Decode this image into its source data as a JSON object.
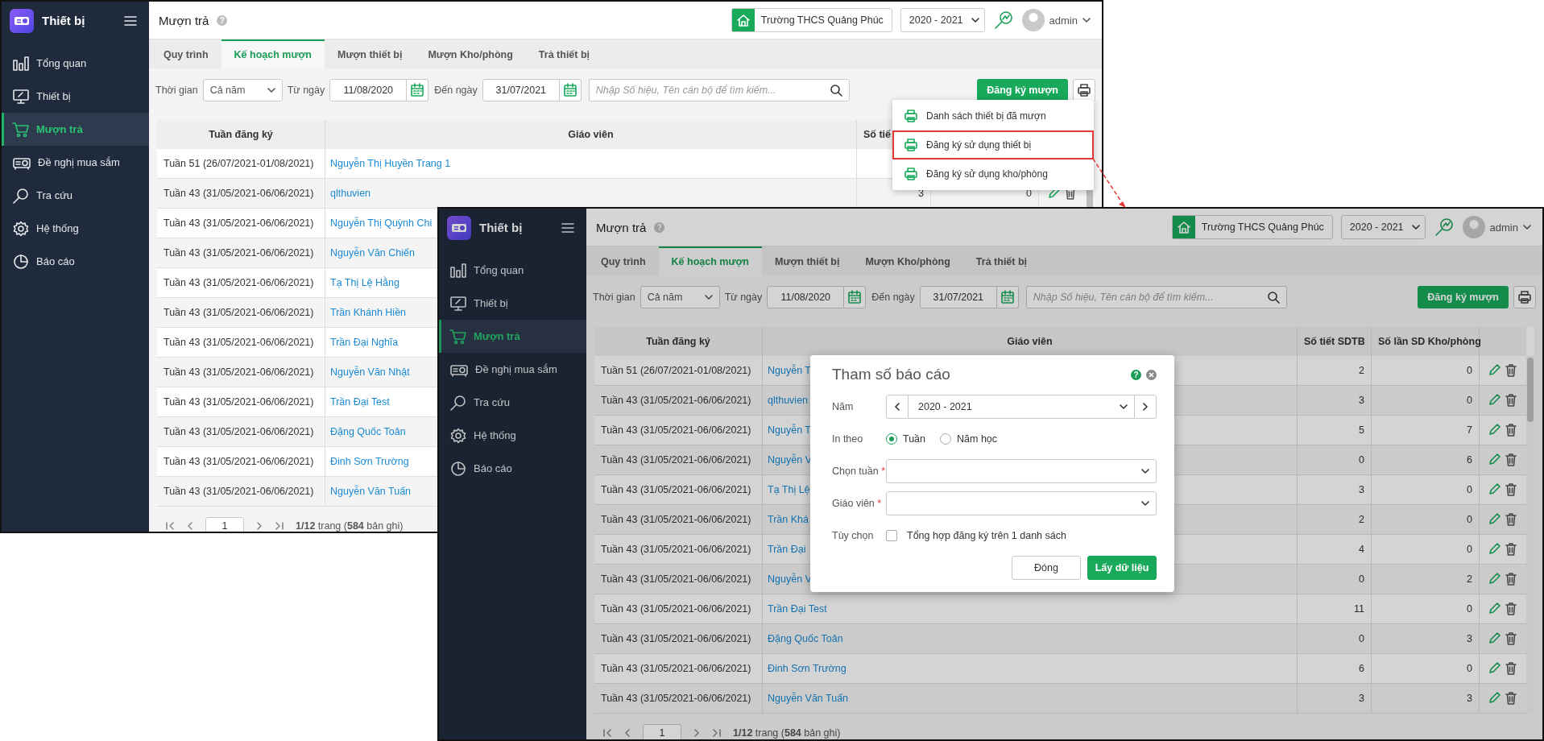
{
  "screens": [
    {
      "brand": "Thiết bị",
      "sidebar": [
        {
          "label": "Tổng quan",
          "selected": false
        },
        {
          "label": "Thiết bị",
          "selected": false
        },
        {
          "label": "Mượn trả",
          "selected": true
        },
        {
          "label": "Đề nghị mua sắm",
          "selected": false
        },
        {
          "label": "Tra cứu",
          "selected": false
        },
        {
          "label": "Hệ thống",
          "selected": false
        },
        {
          "label": "Báo cáo",
          "selected": false
        }
      ],
      "page_title": "Mượn trả",
      "help": "?",
      "school": "Trường THCS Quảng Phúc",
      "year": "2020 - 2021",
      "user": "admin",
      "tabs": [
        {
          "label": "Quy trình",
          "selected": false
        },
        {
          "label": "Kế hoạch mượn",
          "selected": true
        },
        {
          "label": "Mượn thiết bị",
          "selected": false
        },
        {
          "label": "Mượn Kho/phòng",
          "selected": false
        },
        {
          "label": "Trả thiết bị",
          "selected": false
        }
      ],
      "filters": {
        "time_label": "Thời gian",
        "time_value": "Cả năm",
        "from_label": "Từ ngày",
        "from_value": "11/08/2020",
        "to_label": "Đến ngày",
        "to_value": "31/07/2021",
        "search_placeholder": "Nhập Số hiệu, Tên cán bộ để tìm kiếm..."
      },
      "register_button": "Đăng ký mượn",
      "table": {
        "columns": [
          "Tuần đăng ký",
          "Giáo viên",
          "Số tiế"
        ],
        "rows": [
          {
            "week": "Tuần 51 (26/07/2021-01/08/2021)",
            "teacher": "Nguyễn Thị Huyền Trang 1"
          },
          {
            "week": "Tuần 43 (31/05/2021-06/06/2021)",
            "teacher": "qlthuvien",
            "sdtb": "3",
            "kho": "0"
          },
          {
            "week": "Tuần 43 (31/05/2021-06/06/2021)",
            "teacher": "Nguyễn Thị Quỳnh Chi"
          },
          {
            "week": "Tuần 43 (31/05/2021-06/06/2021)",
            "teacher": "Nguyễn Văn Chiến"
          },
          {
            "week": "Tuần 43 (31/05/2021-06/06/2021)",
            "teacher": "Tạ Thị Lệ Hằng"
          },
          {
            "week": "Tuần 43 (31/05/2021-06/06/2021)",
            "teacher": "Trần Khánh Hiền"
          },
          {
            "week": "Tuần 43 (31/05/2021-06/06/2021)",
            "teacher": "Trần Đại Nghĩa"
          },
          {
            "week": "Tuần 43 (31/05/2021-06/06/2021)",
            "teacher": "Nguyễn Văn Nhật"
          },
          {
            "week": "Tuần 43 (31/05/2021-06/06/2021)",
            "teacher": "Trần Đại Test"
          },
          {
            "week": "Tuần 43 (31/05/2021-06/06/2021)",
            "teacher": "Đặng Quốc Toản"
          },
          {
            "week": "Tuần 43 (31/05/2021-06/06/2021)",
            "teacher": "Đinh Sơn Trường"
          },
          {
            "week": "Tuần 43 (31/05/2021-06/06/2021)",
            "teacher": "Nguyễn Văn Tuấn"
          }
        ]
      },
      "pagination": {
        "page": "1",
        "summary": "**1/12** trang (**584** bản ghi)"
      },
      "print_menu": [
        {
          "label": "Danh sách thiết bị đã mượn",
          "highlighted": false
        },
        {
          "label": "Đăng ký sử dụng thiết bị",
          "highlighted": true
        },
        {
          "label": "Đăng ký sử dụng kho/phòng",
          "highlighted": false
        }
      ]
    },
    {
      "brand": "Thiết bị",
      "sidebar": [
        {
          "label": "Tổng quan",
          "selected": false
        },
        {
          "label": "Thiết bị",
          "selected": false
        },
        {
          "label": "Mượn trả",
          "selected": true
        },
        {
          "label": "Đề nghị mua sắm",
          "selected": false
        },
        {
          "label": "Tra cứu",
          "selected": false
        },
        {
          "label": "Hệ thống",
          "selected": false
        },
        {
          "label": "Báo cáo",
          "selected": false
        }
      ],
      "page_title": "Mượn trả",
      "help": "?",
      "school": "Trường THCS Quảng Phúc",
      "year": "2020 - 2021",
      "user": "admin",
      "tabs": [
        {
          "label": "Quy trình",
          "selected": false
        },
        {
          "label": "Kế hoạch mượn",
          "selected": true
        },
        {
          "label": "Mượn thiết bị",
          "selected": false
        },
        {
          "label": "Mượn Kho/phòng",
          "selected": false
        },
        {
          "label": "Trả thiết bị",
          "selected": false
        }
      ],
      "filters": {
        "time_label": "Thời gian",
        "time_value": "Cả năm",
        "from_label": "Từ ngày",
        "from_value": "11/08/2020",
        "to_label": "Đến ngày",
        "to_value": "31/07/2021",
        "search_placeholder": "Nhập Số hiệu, Tên cán bộ để tìm kiếm..."
      },
      "register_button": "Đăng ký mượn",
      "table": {
        "columns": [
          "Tuần đăng ký",
          "Giáo viên",
          "Số tiết SDTB",
          "Số lần SD Kho/phòng"
        ],
        "rows": [
          {
            "week": "Tuần 51 (26/07/2021-01/08/2021)",
            "teacher": "Nguyễn T",
            "sdtb": "2",
            "kho": "0"
          },
          {
            "week": "Tuần 43 (31/05/2021-06/06/2021)",
            "teacher": "qlthuvien",
            "sdtb": "3",
            "kho": "0"
          },
          {
            "week": "Tuần 43 (31/05/2021-06/06/2021)",
            "teacher": "Nguyễn T",
            "sdtb": "5",
            "kho": "7"
          },
          {
            "week": "Tuần 43 (31/05/2021-06/06/2021)",
            "teacher": "Nguyễn V",
            "sdtb": "0",
            "kho": "6"
          },
          {
            "week": "Tuần 43 (31/05/2021-06/06/2021)",
            "teacher": "Tạ Thị Lệ",
            "sdtb": "3",
            "kho": "0"
          },
          {
            "week": "Tuần 43 (31/05/2021-06/06/2021)",
            "teacher": "Trần Khá",
            "sdtb": "2",
            "kho": "0"
          },
          {
            "week": "Tuần 43 (31/05/2021-06/06/2021)",
            "teacher": "Trần Đại",
            "sdtb": "4",
            "kho": "0"
          },
          {
            "week": "Tuần 43 (31/05/2021-06/06/2021)",
            "teacher": "Nguyễn V",
            "sdtb": "0",
            "kho": "2"
          },
          {
            "week": "Tuần 43 (31/05/2021-06/06/2021)",
            "teacher": "Trần Đại Test",
            "sdtb": "11",
            "kho": "0"
          },
          {
            "week": "Tuần 43 (31/05/2021-06/06/2021)",
            "teacher": "Đặng Quốc Toản",
            "sdtb": "0",
            "kho": "3"
          },
          {
            "week": "Tuần 43 (31/05/2021-06/06/2021)",
            "teacher": "Đinh Sơn Trường",
            "sdtb": "6",
            "kho": "0"
          },
          {
            "week": "Tuần 43 (31/05/2021-06/06/2021)",
            "teacher": "Nguyễn Văn Tuấn",
            "sdtb": "3",
            "kho": "3"
          }
        ]
      },
      "pagination": {
        "page": "1",
        "summary": "**1/12** trang (**584** bản ghi)"
      },
      "dialog": {
        "title": "Tham số báo cáo",
        "help": "?",
        "fields": [
          {
            "kind": "stepper",
            "label": "Năm",
            "value": "2020 - 2021"
          },
          {
            "kind": "radio",
            "label": "In theo",
            "options": [
              {
                "label": "Tuần",
                "selected": true
              },
              {
                "label": "Năm học",
                "selected": false
              }
            ]
          },
          {
            "kind": "select",
            "label": "Chọn tuần",
            "required_mark": "*"
          },
          {
            "kind": "select",
            "label": "Giáo viên",
            "required_mark": "*"
          },
          {
            "kind": "checkbox",
            "label": "Tùy chọn",
            "text": "Tổng hợp đăng ký trên 1 danh sách",
            "checked": false
          }
        ],
        "buttons": [
          {
            "label": "Đóng",
            "kind": "secondary"
          },
          {
            "label": "Lấy dữ liệu",
            "kind": "primary"
          }
        ]
      }
    }
  ]
}
